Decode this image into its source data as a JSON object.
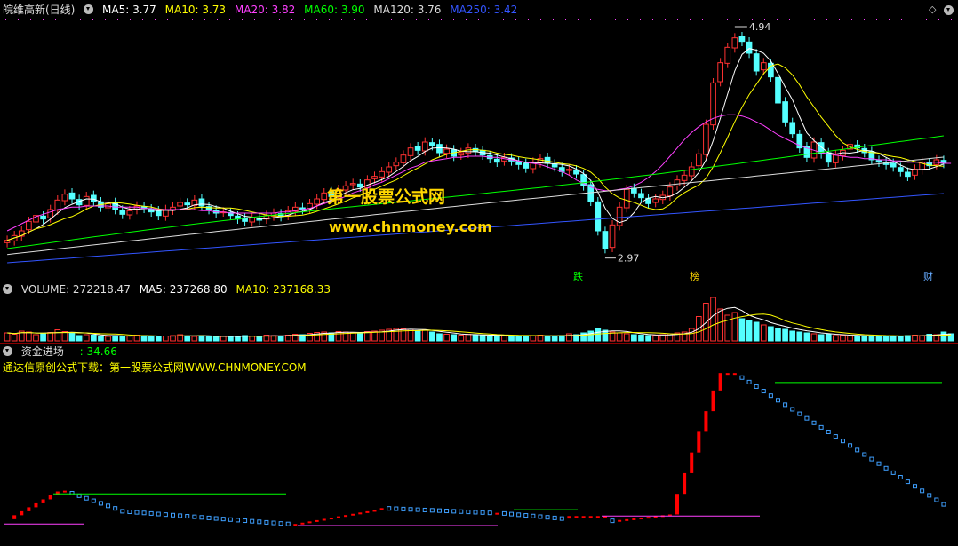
{
  "header": {
    "title": "皖维高新(日线)",
    "ma": [
      {
        "label": "MA5: 3.77",
        "color": "#ffffff"
      },
      {
        "label": "MA10: 3.73",
        "color": "#ffff00"
      },
      {
        "label": "MA20: 3.82",
        "color": "#ff40ff"
      },
      {
        "label": "MA60: 3.90",
        "color": "#00ff00"
      },
      {
        "label": "MA120: 3.76",
        "color": "#dcdcdc"
      },
      {
        "label": "MA250: 3.42",
        "color": "#3355ff"
      }
    ]
  },
  "watermark": {
    "line1": "第一股票公式网",
    "line2": "www.chnmoney.com"
  },
  "events": [
    {
      "label": "跌",
      "color": "#00ff00"
    },
    {
      "label": "榜",
      "color": "#ffd700"
    },
    {
      "label": "财",
      "color": "#66aaff"
    }
  ],
  "volume_header": {
    "volume": "VOLUME: 272218.47",
    "ma5": "MA5: 237268.80",
    "ma10": "MA10: 237168.33"
  },
  "indicator_header": {
    "name": "资金进场",
    "value": ": 34.66",
    "notice": "通达信原创公式下载：第一股票公式网WWW.CHNMONEY.COM"
  },
  "colors": {
    "up": "#ff3232",
    "down": "#54ffff",
    "ma5": "#ffffff",
    "ma10": "#ffff00",
    "ma20": "#ff40ff",
    "ma60": "#00ff00",
    "ma120": "#dcdcdc",
    "ma250": "#3355ff",
    "divider": "#8b0000"
  },
  "chart_data": [
    {
      "type": "candlestick",
      "title": "皖维高新(日线)",
      "high_label": "4.94",
      "low_label": "2.97",
      "price_range": [
        2.9,
        5.0
      ],
      "series_close": [
        3.12,
        3.16,
        3.2,
        3.28,
        3.33,
        3.3,
        3.38,
        3.46,
        3.51,
        3.47,
        3.42,
        3.49,
        3.45,
        3.4,
        3.43,
        3.38,
        3.34,
        3.37,
        3.41,
        3.39,
        3.36,
        3.33,
        3.38,
        3.4,
        3.44,
        3.42,
        3.46,
        3.41,
        3.38,
        3.35,
        3.36,
        3.33,
        3.3,
        3.28,
        3.31,
        3.29,
        3.33,
        3.35,
        3.32,
        3.37,
        3.4,
        3.38,
        3.43,
        3.47,
        3.52,
        3.49,
        3.55,
        3.58,
        3.6,
        3.57,
        3.63,
        3.66,
        3.7,
        3.74,
        3.78,
        3.84,
        3.9,
        3.88,
        3.95,
        3.92,
        3.86,
        3.89,
        3.83,
        3.86,
        3.9,
        3.87,
        3.84,
        3.81,
        3.78,
        3.82,
        3.79,
        3.76,
        3.73,
        3.78,
        3.81,
        3.77,
        3.74,
        3.7,
        3.72,
        3.68,
        3.58,
        3.45,
        3.2,
        3.05,
        3.25,
        3.4,
        3.55,
        3.52,
        3.48,
        3.43,
        3.47,
        3.5,
        3.57,
        3.63,
        3.67,
        3.74,
        3.85,
        4.1,
        4.45,
        4.62,
        4.75,
        4.83,
        4.8,
        4.7,
        4.55,
        4.62,
        4.5,
        4.28,
        4.12,
        4.02,
        3.9,
        3.82,
        3.95,
        3.85,
        3.78,
        3.84,
        3.88,
        3.93,
        3.9,
        3.86,
        3.8,
        3.78,
        3.76,
        3.74,
        3.7,
        3.66,
        3.72,
        3.78,
        3.75,
        3.8,
        3.77
      ],
      "ma20": [
        3.2,
        3.23,
        3.26,
        3.29,
        3.32,
        3.34,
        3.36,
        3.38,
        3.39,
        3.4,
        3.4,
        3.41,
        3.41,
        3.41,
        3.41,
        3.4,
        3.4,
        3.4,
        3.4,
        3.39,
        3.39,
        3.38,
        3.38,
        3.38,
        3.38,
        3.38,
        3.38,
        3.37,
        3.37,
        3.36,
        3.36,
        3.35,
        3.35,
        3.35,
        3.35,
        3.35,
        3.35,
        3.35,
        3.36,
        3.36,
        3.37,
        3.38,
        3.39,
        3.41,
        3.43,
        3.45,
        3.47,
        3.49,
        3.52,
        3.54,
        3.56,
        3.59,
        3.61,
        3.64,
        3.67,
        3.7,
        3.73,
        3.75,
        3.78,
        3.79,
        3.8,
        3.81,
        3.82,
        3.82,
        3.83,
        3.83,
        3.83,
        3.82,
        3.82,
        3.81,
        3.8,
        3.79,
        3.78,
        3.77,
        3.76,
        3.74,
        3.72,
        3.7,
        3.67,
        3.63,
        3.6,
        3.57,
        3.55,
        3.54,
        3.54,
        3.55,
        3.56,
        3.58,
        3.61,
        3.65,
        3.7,
        3.76,
        3.83,
        3.9,
        3.97,
        4.03,
        4.08,
        4.12,
        4.15,
        4.17,
        4.18,
        4.18,
        4.17,
        4.15,
        4.12,
        4.09,
        4.05,
        4.01,
        3.98,
        3.95,
        3.92,
        3.9,
        3.88,
        3.86,
        3.85,
        3.84,
        3.83,
        3.82,
        3.82,
        3.81,
        3.81,
        3.8,
        3.8,
        3.79,
        3.79,
        3.78,
        3.78,
        3.78,
        3.78,
        3.78,
        3.77,
        3.77
      ]
    },
    {
      "type": "bar",
      "title": "VOLUME",
      "values_relative": [
        0.18,
        0.15,
        0.22,
        0.2,
        0.14,
        0.16,
        0.19,
        0.25,
        0.21,
        0.17,
        0.12,
        0.14,
        0.13,
        0.11,
        0.1,
        0.12,
        0.1,
        0.11,
        0.13,
        0.12,
        0.1,
        0.09,
        0.11,
        0.12,
        0.14,
        0.11,
        0.1,
        0.12,
        0.1,
        0.09,
        0.1,
        0.11,
        0.1,
        0.12,
        0.11,
        0.1,
        0.13,
        0.12,
        0.11,
        0.13,
        0.15,
        0.14,
        0.17,
        0.19,
        0.2,
        0.18,
        0.21,
        0.2,
        0.19,
        0.17,
        0.21,
        0.22,
        0.24,
        0.26,
        0.28,
        0.27,
        0.26,
        0.22,
        0.24,
        0.2,
        0.16,
        0.15,
        0.14,
        0.13,
        0.15,
        0.14,
        0.12,
        0.11,
        0.13,
        0.12,
        0.11,
        0.1,
        0.11,
        0.12,
        0.13,
        0.11,
        0.1,
        0.12,
        0.16,
        0.14,
        0.18,
        0.22,
        0.28,
        0.24,
        0.2,
        0.18,
        0.16,
        0.14,
        0.13,
        0.12,
        0.13,
        0.14,
        0.16,
        0.18,
        0.2,
        0.28,
        0.55,
        0.85,
        0.98,
        0.72,
        0.58,
        0.64,
        0.5,
        0.46,
        0.42,
        0.36,
        0.32,
        0.28,
        0.26,
        0.22,
        0.2,
        0.18,
        0.16,
        0.14,
        0.15,
        0.12,
        0.13,
        0.11,
        0.12,
        0.1,
        0.11,
        0.12,
        0.1,
        0.11,
        0.1,
        0.12,
        0.13,
        0.12,
        0.15,
        0.14,
        0.2,
        0.16
      ]
    },
    {
      "type": "line",
      "title": "资金进场",
      "value": 34.66
    }
  ]
}
